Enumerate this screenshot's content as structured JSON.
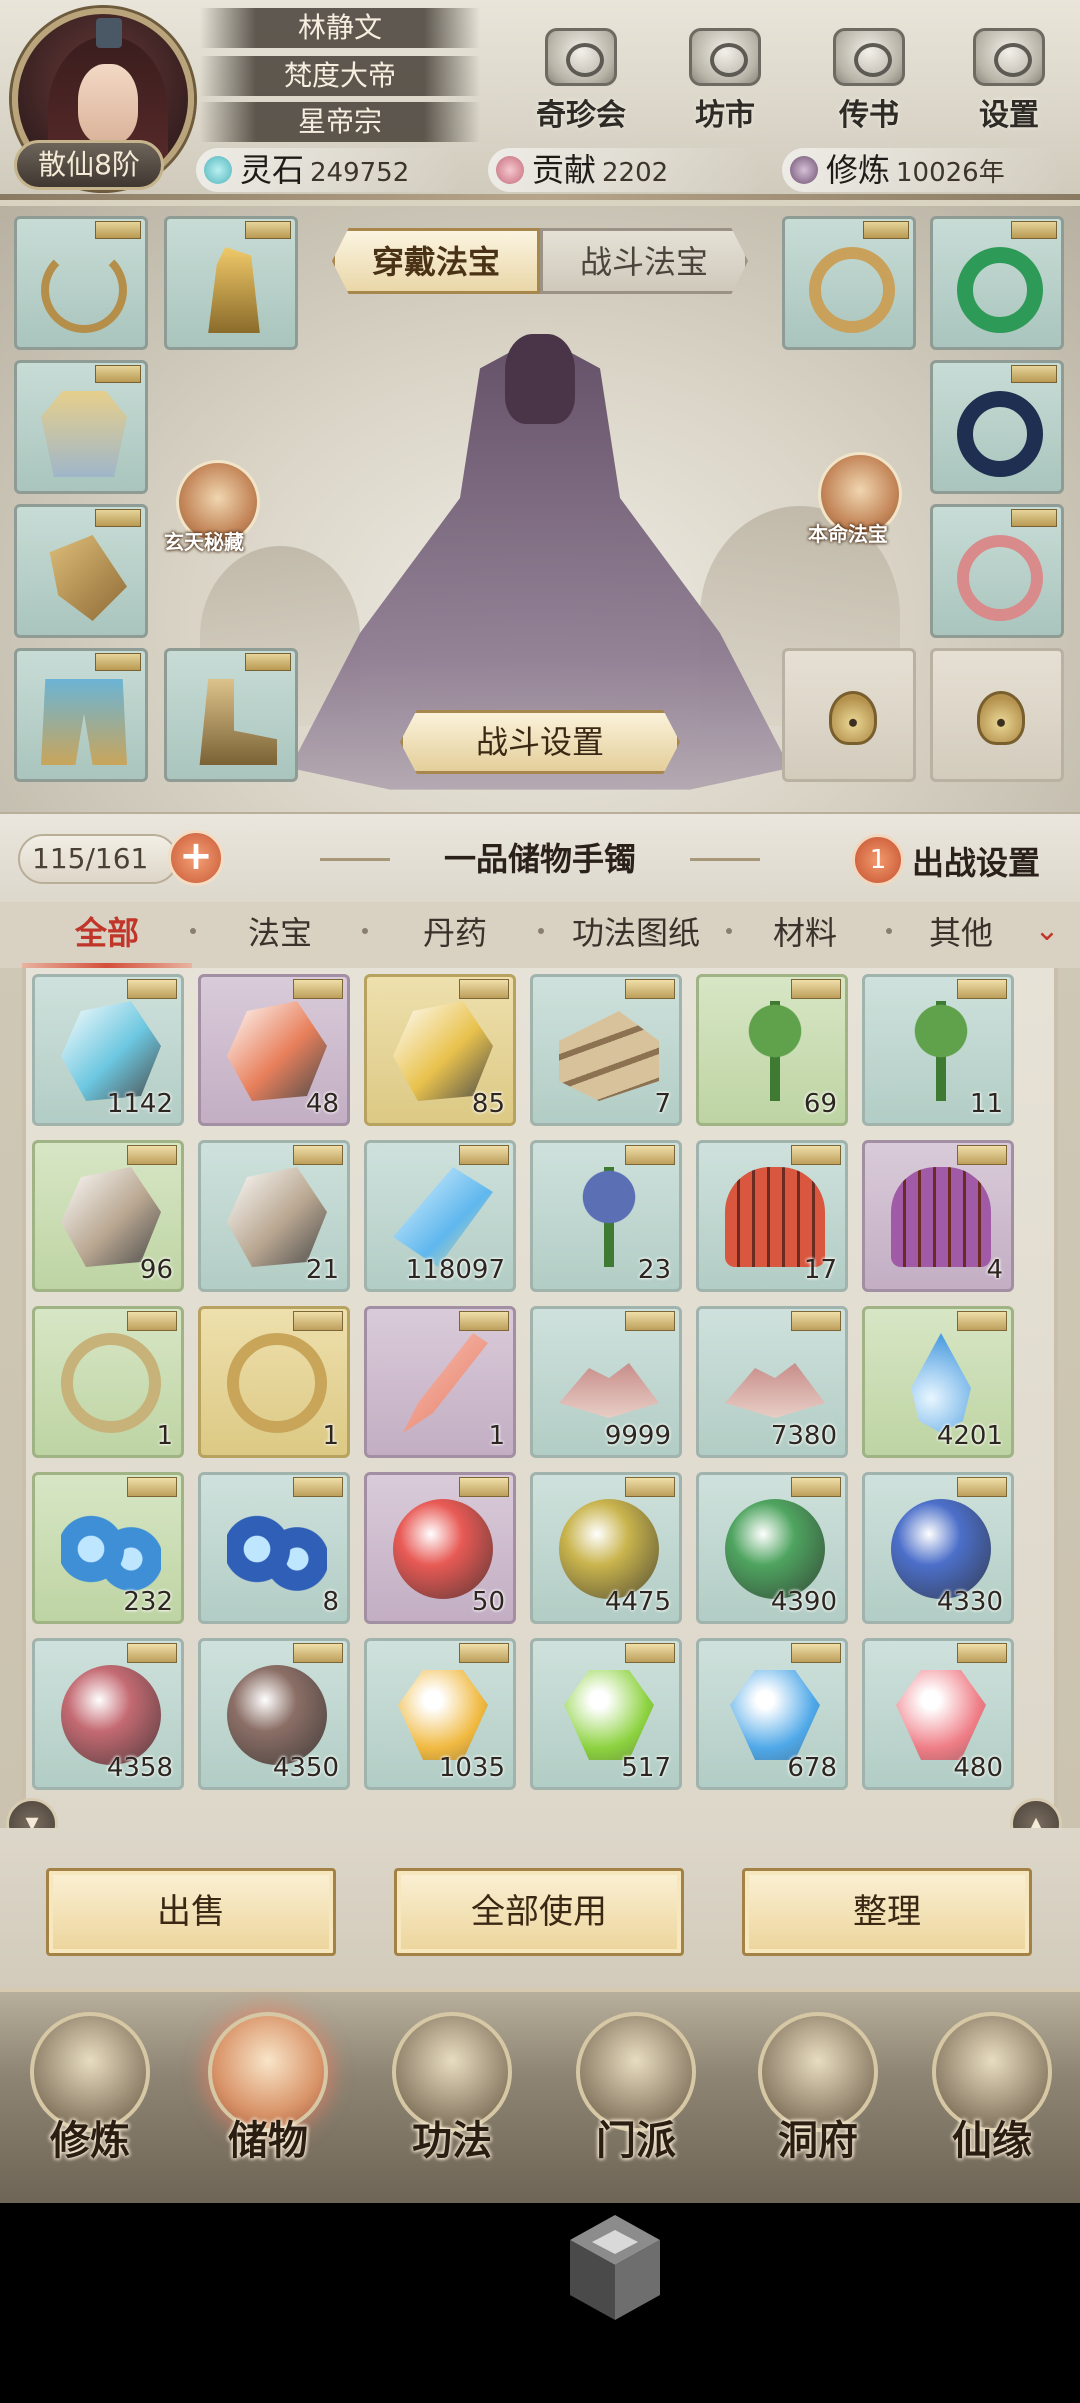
{
  "player": {
    "name": "林静文",
    "title": "梵度大帝",
    "sect": "星帝宗",
    "rank": "散仙8阶"
  },
  "top_buttons": [
    {
      "label": "奇珍会",
      "icon": "treasure-pavilion-icon"
    },
    {
      "label": "坊市",
      "icon": "market-icon"
    },
    {
      "label": "传书",
      "icon": "scroll-mail-icon"
    },
    {
      "label": "设置",
      "icon": "gear-icon"
    }
  ],
  "resources": [
    {
      "label": "灵石",
      "value": "249752",
      "color": "#6fc3c9"
    },
    {
      "label": "贡献",
      "value": "2202",
      "color": "#d98b9a"
    },
    {
      "label": "修炼",
      "value": "10026年",
      "color": "#8a6e8c"
    }
  ],
  "equip": {
    "tab_active": "穿戴法宝",
    "tab_inactive": "战斗法宝",
    "left_orb_label": "玄天秘藏",
    "right_orb_label": "本命法宝",
    "battle_settings": "战斗设置"
  },
  "bag": {
    "capacity": "115/161",
    "plus": "+",
    "title": "一品储物手镯",
    "deploy_count": "1",
    "deploy_label": "出战设置"
  },
  "categories": [
    "全部",
    "法宝",
    "丹药",
    "功法图纸",
    "材料",
    "其他"
  ],
  "category_more": "⌄",
  "items": [
    {
      "icon": "blue-crystal-icon",
      "count": "1142",
      "color": "#6cc7e0",
      "bg": "teal"
    },
    {
      "icon": "red-stone-icon",
      "count": "48",
      "color": "#e8805c",
      "bg": "purple"
    },
    {
      "icon": "gold-stone-icon",
      "count": "85",
      "color": "#e9c24d",
      "bg": "gold"
    },
    {
      "icon": "wood-logs-icon",
      "count": "7",
      "color": "#c9b089",
      "bg": "teal"
    },
    {
      "icon": "herb-sprout-icon",
      "count": "69",
      "color": "#5fa24b",
      "bg": "green"
    },
    {
      "icon": "herb-sprout-icon",
      "count": "11",
      "color": "#5fa24b",
      "bg": "teal"
    },
    {
      "icon": "ore-rock-icon",
      "count": "96",
      "color": "#b9a791",
      "bg": "green"
    },
    {
      "icon": "ore-rock-icon",
      "count": "21",
      "color": "#b9a791",
      "bg": "teal"
    },
    {
      "icon": "spirit-shard-icon",
      "count": "118097",
      "color": "#5fb7ee",
      "bg": "teal"
    },
    {
      "icon": "blue-flower-icon",
      "count": "23",
      "color": "#5a6fb4",
      "bg": "teal"
    },
    {
      "icon": "fire-cactus-icon",
      "count": "17",
      "color": "#d9563f",
      "bg": "teal"
    },
    {
      "icon": "violet-cactus-icon",
      "count": "4",
      "color": "#a05aa6",
      "bg": "purple"
    },
    {
      "icon": "jade-ring-icon",
      "count": "1",
      "color": "#c7b27a",
      "bg": "green"
    },
    {
      "icon": "gold-ring-icon",
      "count": "1",
      "color": "#c9a55a",
      "bg": "gold"
    },
    {
      "icon": "red-dagger-icon",
      "count": "1",
      "color": "#e77760",
      "bg": "purple"
    },
    {
      "icon": "sand-pile-icon",
      "count": "9999",
      "color": "#b76a6a",
      "bg": "teal"
    },
    {
      "icon": "sand-pile-icon",
      "count": "7380",
      "color": "#b76a6a",
      "bg": "teal"
    },
    {
      "icon": "water-drop-icon",
      "count": "4201",
      "color": "#4e9ee0",
      "bg": "green"
    },
    {
      "icon": "water-wave-icon",
      "count": "232",
      "color": "#3e8fd6",
      "bg": "green"
    },
    {
      "icon": "water-wave-icon",
      "count": "8",
      "color": "#2f5fb7",
      "bg": "teal"
    },
    {
      "icon": "red-orb-icon",
      "count": "50",
      "color": "#e85a55",
      "bg": "purple"
    },
    {
      "icon": "yellow-orb-icon",
      "count": "4475",
      "color": "#c9b44d",
      "bg": "teal"
    },
    {
      "icon": "green-orb-icon",
      "count": "4390",
      "color": "#4fa460",
      "bg": "teal"
    },
    {
      "icon": "blue-orb-icon",
      "count": "4330",
      "color": "#4c6fc9",
      "bg": "teal"
    },
    {
      "icon": "pink-orb-icon",
      "count": "4358",
      "color": "#c46a72",
      "bg": "teal"
    },
    {
      "icon": "brown-orb-icon",
      "count": "4350",
      "color": "#8b6f66",
      "bg": "teal"
    },
    {
      "icon": "yellow-gem-icon",
      "count": "1035",
      "color": "#f0b940",
      "bg": "teal"
    },
    {
      "icon": "green-gem-icon",
      "count": "517",
      "color": "#8cd23f",
      "bg": "teal"
    },
    {
      "icon": "blue-gem-icon",
      "count": "678",
      "color": "#4fa8e8",
      "bg": "teal"
    },
    {
      "icon": "pink-gem-icon",
      "count": "480",
      "color": "#ef7d86",
      "bg": "teal"
    }
  ],
  "actions": {
    "sell": "出售",
    "use_all": "全部使用",
    "sort": "整理"
  },
  "nav": [
    {
      "label": "修炼",
      "icon": "cultivate-icon",
      "active": false
    },
    {
      "label": "储物",
      "icon": "storage-bag-icon",
      "active": true
    },
    {
      "label": "功法",
      "icon": "skill-scroll-icon",
      "active": false
    },
    {
      "label": "门派",
      "icon": "sect-gate-icon",
      "active": false
    },
    {
      "label": "洞府",
      "icon": "cave-dwelling-icon",
      "active": false
    },
    {
      "label": "仙缘",
      "icon": "immortal-fate-icon",
      "active": false
    }
  ]
}
